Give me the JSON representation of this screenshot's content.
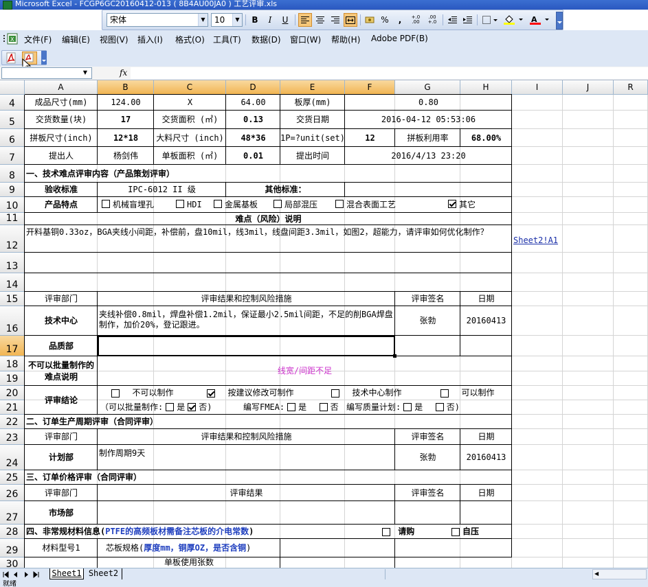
{
  "window": {
    "title": "Microsoft Excel - FCGP6GC20160412-013 ( 8B4AU00JA0 ) 工艺评审.xls"
  },
  "format_toolbar": {
    "font_name": "宋体",
    "font_size": "10",
    "bold": "B",
    "italic": "I",
    "underline": "U",
    "percent": "%",
    "comma": ",",
    "inc_decimal": "+.0 .00",
    "dec_decimal": ".00 +.0"
  },
  "menu": {
    "items": [
      "文件(F)",
      "编辑(E)",
      "视图(V)",
      "插入(I)",
      "格式(O)",
      "工具(T)",
      "数据(D)",
      "窗口(W)",
      "帮助(H)",
      "Adobe PDF(B)"
    ]
  },
  "formula_bar": {
    "name_box": "",
    "fx": "fx",
    "content": ""
  },
  "columns": [
    "A",
    "B",
    "C",
    "D",
    "E",
    "F",
    "G",
    "H",
    "I",
    "J",
    "R"
  ],
  "rows": [
    "4",
    "5",
    "6",
    "7",
    "8",
    "9",
    "10",
    "11",
    "12",
    "13",
    "14",
    "15",
    "16",
    "17",
    "18",
    "19",
    "20",
    "21",
    "22",
    "23",
    "24",
    "25",
    "26",
    "27",
    "28",
    "29",
    "30"
  ],
  "sheet": {
    "r4": {
      "a": "成品尺寸(mm)",
      "b": "124.00",
      "c": "X",
      "d": "64.00",
      "e": "板厚(mm)",
      "fg": "0.80"
    },
    "r5": {
      "a": "交货数量(块)",
      "b": "17",
      "c": "交货面积 (㎡)",
      "d": "0.13",
      "e": "交货日期",
      "fg": "2016-04-12 05:53:06"
    },
    "r6": {
      "a": "拼板尺寸(inch)",
      "b": "12*18",
      "c": "大料尺寸 (inch)",
      "d": "48*36",
      "e": "1P=?unit(set)",
      "f": "12",
      "g": "拼板利用率",
      "h": "68.00%"
    },
    "r7": {
      "a": "提出人",
      "b": "杨剑伟",
      "c": "单板面积 (㎡)",
      "d": "0.01",
      "e": "提出时间",
      "fg": "2016/4/13 23:20"
    },
    "r8": {
      "a": "一、技术难点评审内容（产品策划评审）"
    },
    "r9": {
      "a": "验收标准",
      "bc": "IPC-6012 II 级",
      "de": "其他标准："
    },
    "r10": {
      "a": "产品特点",
      "options": [
        {
          "label": "机械盲埋孔",
          "checked": false
        },
        {
          "label": "HDI",
          "checked": false
        },
        {
          "label": "金属基板",
          "checked": false
        },
        {
          "label": "局部混压",
          "checked": false
        },
        {
          "label": "混合表面工艺",
          "checked": false
        },
        {
          "label": "其它",
          "checked": true
        }
      ]
    },
    "r11": {
      "title": "难点（风险）说明"
    },
    "r12": {
      "text": "开料基铜0.33oz，BGA夹线小间距，补偿前，盘10mil，线3mil，线盘间距3.3mil，如图2，超能力，请评审如何优化制作？",
      "link": "Sheet2!A1"
    },
    "r15": {
      "a": "评审部门",
      "b": "评审结果和控制风险措施",
      "g": "评审签名",
      "h": "日期"
    },
    "r16": {
      "a": "技术中心",
      "b": "夹线补偿0.8mil，焊盘补偿1.2mil，保证最小2.5mil间距，不足的削BGA焊盘制作，加价20%，登记跟进。",
      "g": "张勃",
      "h": "20160413"
    },
    "r17": {
      "a": "品质部"
    },
    "r18": {
      "a": "不可以批量制作的难点说明",
      "b": "线宽/间距不足"
    },
    "r20": {
      "a": "评审结论",
      "opt1": "不可以制作",
      "opt2": "按建议修改可制作",
      "opt3": "技术中心制作",
      "opt4": "可以制作"
    },
    "r21": {
      "batch_label": "（可以批量制作:",
      "yes": "是",
      "no": "否)",
      "fmea": "编写FMEA:",
      "fmea_yes": "是",
      "fmea_no": "否",
      "qp": "编写质量计划:",
      "qp_yes": "是",
      "qp_no": "否)"
    },
    "r22": {
      "a": "二、订单生产周期评审（合同评审）"
    },
    "r23": {
      "a": "评审部门",
      "b": "评审结果和控制风险措施",
      "g": "评审签名",
      "h": "日期"
    },
    "r24": {
      "a": "计划部",
      "b": "制作周期9天",
      "g": "张勃",
      "h": "20160413"
    },
    "r25": {
      "a": "三、订单价格评审（合同评审）"
    },
    "r26": {
      "a": "评审部门",
      "b": "评审结果",
      "g": "评审签名",
      "h": "日期"
    },
    "r27": {
      "a": "市场部"
    },
    "r28": {
      "a_prefix": "四、非常规材料信息(",
      "a_blue": "PTFE的高频板材需备注芯板的介电常数",
      "a_suffix": ")",
      "purchase": "请购",
      "stock": "自压"
    },
    "r29": {
      "a": "材料型号1",
      "b_prefix": "芯板规格(",
      "b_blue": "厚度mm，铜厚OZ，是否含铜",
      "b_suffix": ")"
    },
    "r30": {
      "b": "单板使用张数"
    }
  },
  "sheet_tabs": [
    "Sheet1",
    "Sheet2"
  ],
  "status": {
    "text": "就绪"
  },
  "colors": {
    "header_highlight": "#f1b553",
    "link": "#1a2fa8",
    "magenta": "#cc33cc",
    "blue_text": "#1f3fbf"
  }
}
